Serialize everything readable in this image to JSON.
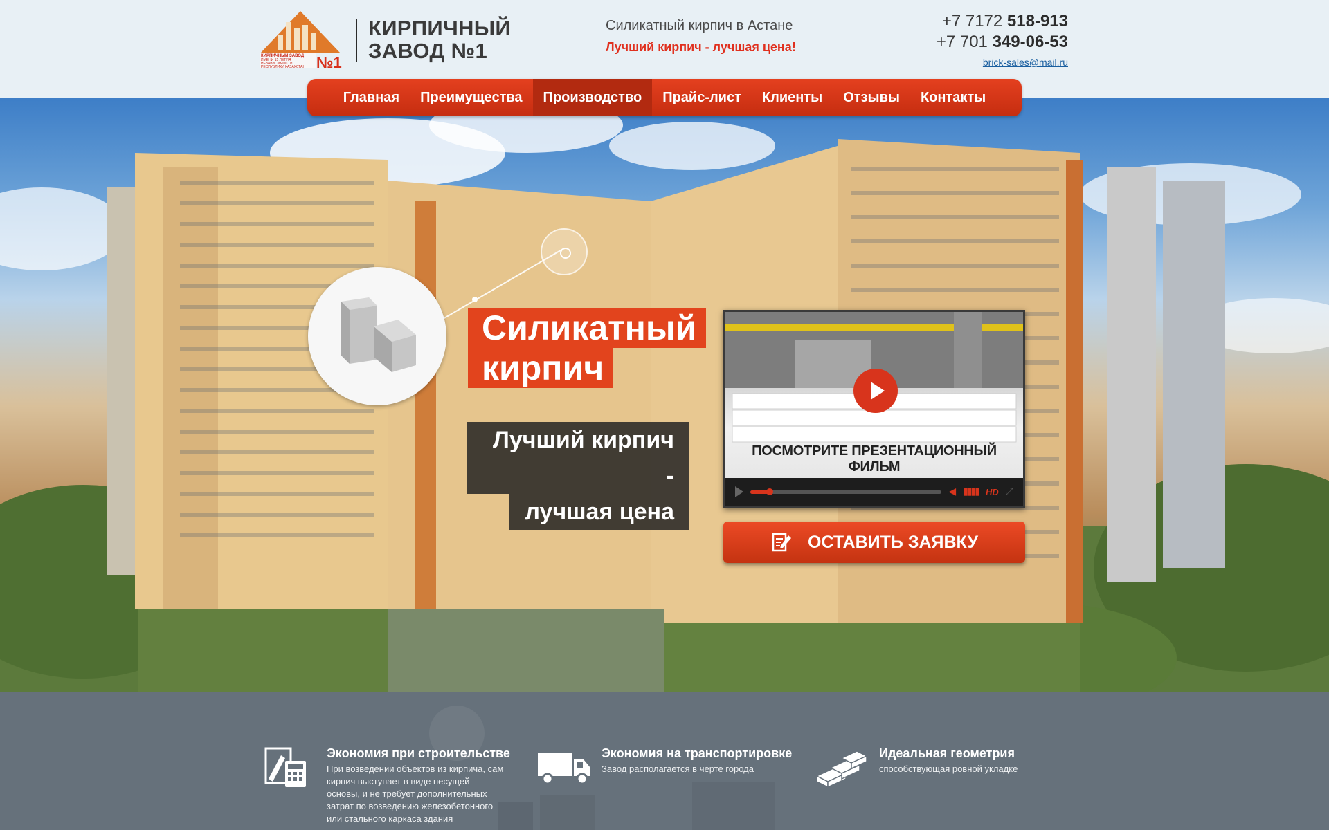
{
  "header": {
    "logo": {
      "caption_lines": [
        "КИРПИЧНЫЙ ЗАВОД",
        "ИМЕНИ 15 ЛЕТИЯ",
        "НЕЗАВИСИМОСТИ",
        "РЕСПУБЛИКИ КАЗАХСТАН"
      ],
      "number": "№1"
    },
    "brand": {
      "line1": "КИРПИЧНЫЙ",
      "line2": "ЗАВОД №1"
    },
    "tagline": "Силикатный кирпич в Астане",
    "slogan": "Лучший кирпич - лучшая цена!",
    "phones": [
      {
        "code": "+7 7172",
        "number": "518-913"
      },
      {
        "code": "+7 701",
        "number": "349-06-53"
      }
    ],
    "email": "brick-sales@mail.ru"
  },
  "nav": {
    "items": [
      {
        "label": "Главная",
        "active": false
      },
      {
        "label": "Преимущества",
        "active": false
      },
      {
        "label": "Производство",
        "active": true
      },
      {
        "label": "Прайс-лист",
        "active": false
      },
      {
        "label": "Клиенты",
        "active": false
      },
      {
        "label": "Отзывы",
        "active": false
      },
      {
        "label": "Контакты",
        "active": false
      }
    ]
  },
  "hero": {
    "title_line1": "Силикатный",
    "title_line2": "кирпич",
    "subtitle_line1": "Лучший кирпич -",
    "subtitle_line2": "лучшая цена",
    "video_caption": "ПОСМОТРИТЕ ПРЕЗЕНТАЦИОННЫЙ ФИЛЬМ",
    "video_progress": 0.1,
    "video_hd": "HD",
    "order_button": "ОСТАВИТЬ ЗАЯВКУ"
  },
  "features": [
    {
      "icon": "calculator-document-icon",
      "title": "Экономия при строительстве",
      "text": [
        "При возведении объектов из кирпича, сам",
        "кирпич выступает в виде несущей",
        "основы, и не требует дополнительных",
        "затрат по возведению железобетонного",
        "или стального каркаса здания"
      ]
    },
    {
      "icon": "truck-icon",
      "title": "Экономия на транспортировке",
      "text": [
        "Завод располагается в черте города"
      ]
    },
    {
      "icon": "bricks-icon",
      "title": "Идеальная геометрия",
      "text": [
        "способствующая ровной укладке"
      ]
    }
  ],
  "colors": {
    "accent": "#e2441d",
    "nav": "#d3361a",
    "text_dark": "#3a3a3a",
    "header_bg": "#e8f0f5",
    "features_bg": "#66717b"
  }
}
